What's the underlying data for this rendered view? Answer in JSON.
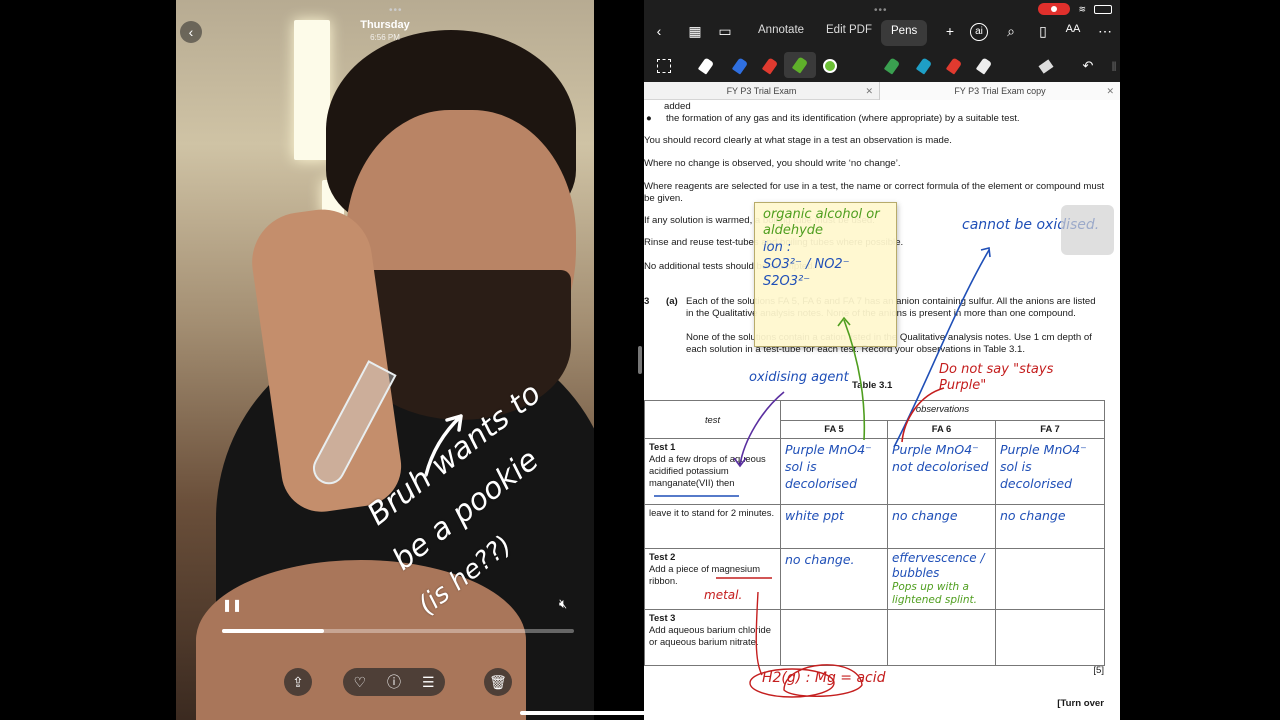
{
  "photos": {
    "day": "Thursday",
    "time": "6:56 PM",
    "scribble_lines": [
      "Bruh wants to",
      "be a pookie",
      "(is he??)"
    ],
    "playback_fraction": 0.29
  },
  "status": {
    "wifi": "wifi-icon",
    "battery": "battery-icon"
  },
  "app": {
    "tabs": [
      "Annotate",
      "Edit PDF",
      "Pens"
    ],
    "active_tab": "Pens",
    "doc_tabs": [
      "FY P3 Trial Exam",
      "FY P3 Trial Exam  copy"
    ],
    "pen_colors": [
      "#ffffff",
      "#2f6fe0",
      "#e03a2f",
      "#5fb02a",
      "#6cc036",
      "#3aa050",
      "#1e9fc6",
      "#e03a2f"
    ],
    "ai_label": "ai"
  },
  "doc": {
    "line_added": "added",
    "bullet_gas": "the formation of any gas and its identification (where appropriate) by a suitable test.",
    "p_record": "You should record clearly at what stage in a test an observation is made.",
    "p_no_change": "Where no change is observed, you should write ‘no change’.",
    "p_reagents": "Where reagents are selected for use in a test, the name or correct formula of the element or compound must be given.",
    "p_warmed": "If any solution is warmed, a boiling tube must be used.",
    "p_rinse": "Rinse and reuse test-tubes and boiling tubes where possible.",
    "p_no_additional": "No additional tests should be attempted.",
    "q_num": "3",
    "q_part": "(a)",
    "q_text": "Each of the solutions FA 5, FA 6 and FA 7 has an anion containing sulfur. All the anions are listed in the Qualitative analysis notes. None of the anions is present in more than one compound.",
    "q_text2": "None of the solutions contain a cation listed in the Qualitative analysis notes. Use 1 cm depth of each solution in a test-tube for each test. Record your observations in Table 3.1.",
    "table_caption": "Table 3.1",
    "th_test": "test",
    "th_observations": "observations",
    "solutions": [
      "FA 5",
      "FA 6",
      "FA 7"
    ],
    "test1_title": "Test 1",
    "test1_text": "Add a few drops of aqueous acidified potassium manganate(VII) then",
    "test1b_text": "leave it to stand for 2 minutes.",
    "test2_title": "Test 2",
    "test2_text": "Add a piece of magnesium ribbon.",
    "test3_title": "Test 3",
    "test3_text": "Add aqueous barium chloride or aqueous barium nitrate.",
    "marks": "[5]",
    "turn_over": "[Turn over"
  },
  "handwriting": {
    "t1_fa5": "Purple MnO4⁻ sol is decolorised",
    "t1_fa6": "Purple MnO4⁻ not decolorised",
    "t1_fa7": "Purple MnO4⁻ sol is decolorised",
    "t1b_fa5": "white ppt",
    "t1b_fa6": "no change",
    "t1b_fa7": "no change",
    "t2_fa5": "no change.",
    "t2_fa6": "effervescence / bubbles",
    "t2_fa6_green": "Pops up with a lightened splint.",
    "sticky_green": "organic alcohol or aldehyde",
    "sticky_ion": "ion :",
    "sticky_anions": "SO3²⁻ / NO2⁻",
    "sticky_anion3": "S2O3²⁻",
    "cannot_oxidised": "cannot be oxidised.",
    "oxidising_agent": "oxidising agent",
    "do_not_say": "Do not say \"stays Purple\"",
    "metal": "metal.",
    "h2_note": "H2(g) : Mg = acid"
  }
}
